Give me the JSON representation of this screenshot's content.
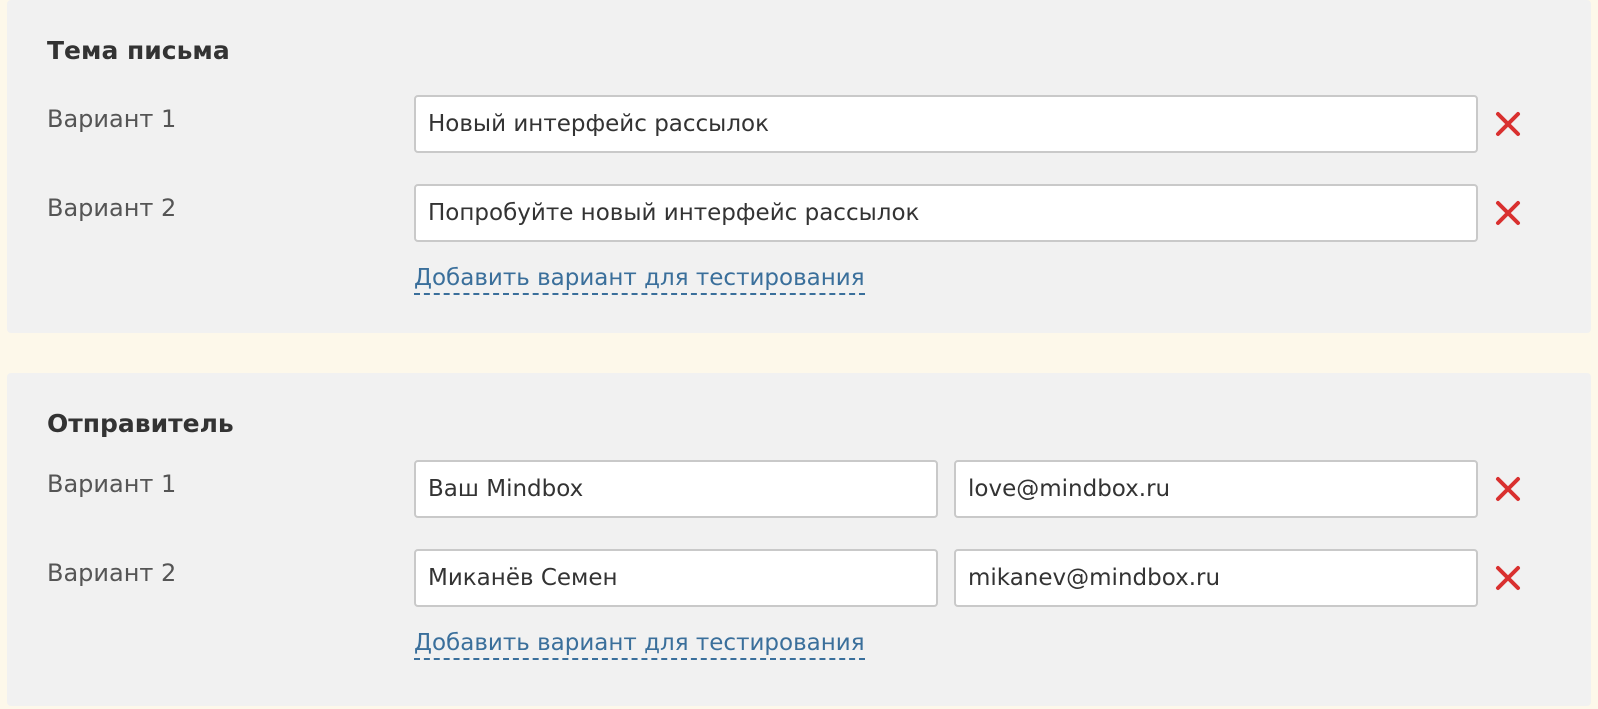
{
  "subject_section": {
    "title": "Тема письма",
    "variants": [
      {
        "label": "Вариант 1",
        "value": "Новый интерфейс рассылок"
      },
      {
        "label": "Вариант 2",
        "value": "Попробуйте новый интерфейс рассылок"
      }
    ],
    "add_link": "Добавить вариант для тестирования"
  },
  "sender_section": {
    "title": "Отправитель",
    "variants": [
      {
        "label": "Вариант 1",
        "name": "Ваш Mindbox",
        "email": "love@mindbox.ru"
      },
      {
        "label": "Вариант 2",
        "name": "Миканёв Семен",
        "email": "mikanev@mindbox.ru"
      }
    ],
    "add_link": "Добавить вариант для тестирования"
  },
  "icons": {
    "remove": "close-icon"
  },
  "colors": {
    "page_background": "#fdf8ea",
    "panel_background": "#f1f1f1",
    "remove_icon": "#d9302f",
    "link": "#3a6f9b"
  }
}
